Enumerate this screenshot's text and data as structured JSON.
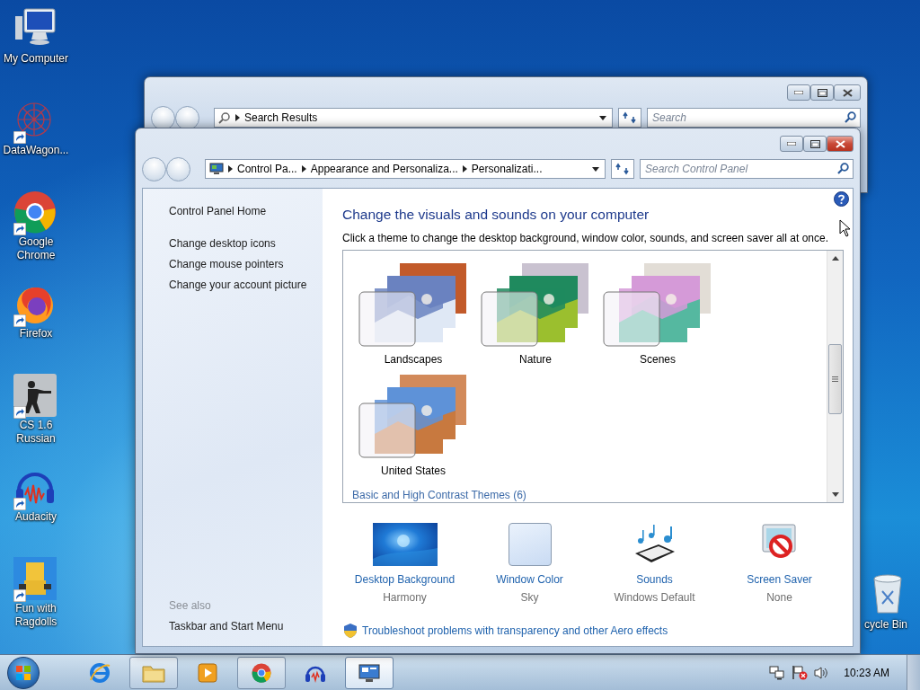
{
  "desktop_icons": [
    {
      "label": "My Computer",
      "kind": "computer",
      "shortcut": false
    },
    {
      "label": "DataWagon...",
      "kind": "webring",
      "shortcut": true
    },
    {
      "label": "Google Chrome",
      "kind": "chrome",
      "shortcut": true
    },
    {
      "label": "Firefox",
      "kind": "firefox",
      "shortcut": true
    },
    {
      "label": "CS 1.6 Russian",
      "kind": "game",
      "shortcut": true
    },
    {
      "label": "Audacity",
      "kind": "audio",
      "shortcut": true
    },
    {
      "label": "Fun with Ragdolls",
      "kind": "ragdoll",
      "shortcut": true
    }
  ],
  "recycle_bin": {
    "label": "cycle Bin"
  },
  "back_window": {
    "address": {
      "crumbs": [
        "Search Results"
      ]
    },
    "search": {
      "placeholder": "Search"
    }
  },
  "window": {
    "address": {
      "crumbs": [
        "Control Pa...",
        "Appearance and Personaliza...",
        "Personalizati..."
      ]
    },
    "search": {
      "placeholder": "Search Control Panel"
    },
    "sidebar": {
      "home": "Control Panel Home",
      "tasks": [
        "Change desktop icons",
        "Change mouse pointers",
        "Change your account picture"
      ],
      "see_also_heading": "See also",
      "see_also": [
        "Taskbar and Start Menu"
      ]
    },
    "heading": "Change the visuals and sounds on your computer",
    "description": "Click a theme to change the desktop background, window color, sounds, and screen saver all at once.",
    "themes": [
      {
        "name": "Landscapes"
      },
      {
        "name": "Nature"
      },
      {
        "name": "Scenes"
      },
      {
        "name": "United States"
      }
    ],
    "group_heading": "Basic and High Contrast Themes (6)",
    "settings": [
      {
        "kind": "wallpaper",
        "label": "Desktop Background",
        "value": "Harmony"
      },
      {
        "kind": "color",
        "label": "Window Color",
        "value": "Sky"
      },
      {
        "kind": "sounds",
        "label": "Sounds",
        "value": "Windows Default"
      },
      {
        "kind": "saver",
        "label": "Screen Saver",
        "value": "None"
      }
    ],
    "troubleshoot_link": "Troubleshoot problems with transparency and other Aero effects"
  },
  "taskbar": {
    "items": [
      {
        "kind": "ie",
        "open": false,
        "active": false
      },
      {
        "kind": "folder",
        "open": true,
        "active": false
      },
      {
        "kind": "media",
        "open": false,
        "active": false
      },
      {
        "kind": "chrome",
        "open": true,
        "active": false
      },
      {
        "kind": "audio",
        "open": false,
        "active": false
      },
      {
        "kind": "panel",
        "open": true,
        "active": true
      }
    ],
    "clock": "10:23 AM"
  }
}
